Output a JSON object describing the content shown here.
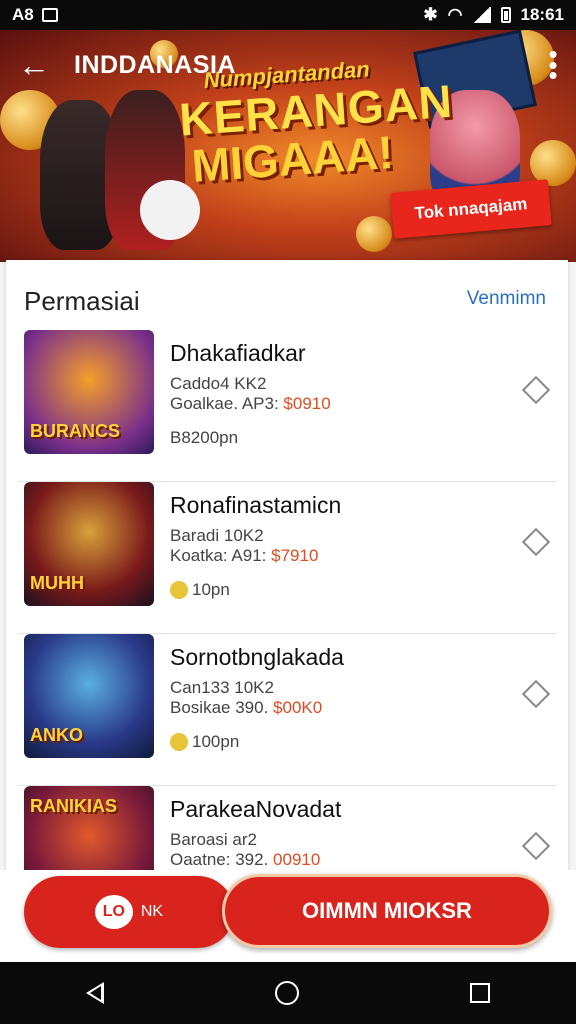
{
  "status_bar": {
    "left_text": "A8",
    "time": "18:61"
  },
  "header": {
    "title": "INDDANASIA"
  },
  "banner": {
    "line1": "Numpjantandan",
    "line2": "KERANGAN",
    "line3": "MIGAAA!",
    "cta": "Tok nnaqajam"
  },
  "section": {
    "title": "Permasiai",
    "view_all": "Venmimn"
  },
  "items": [
    {
      "name": "Dhakafiadkar",
      "meta1": "Caddo4 KK2",
      "meta2_prefix": "Goalkae. AP3:",
      "price": "$0910",
      "duration": "B8200pn",
      "thumb_text": "BURANCS",
      "has_dot": false
    },
    {
      "name": "Ronafinastamicn",
      "meta1": "Baradi 10K2",
      "meta2_prefix": "Koatka: A91:",
      "price": "$7910",
      "duration": "10pn",
      "thumb_text": "MUHH",
      "has_dot": true
    },
    {
      "name": "Sornotbnglakada",
      "meta1": "Can133 10K2",
      "meta2_prefix": "Bosikae 390.",
      "price": "$00K0",
      "duration": "100pn",
      "thumb_text": "ANKO",
      "has_dot": true
    },
    {
      "name": "ParakeaNovadat",
      "meta1": "Baroasi ar2",
      "meta2_prefix": "Oaatne: 392.",
      "price": "00910",
      "duration": "",
      "thumb_text": "RANIKIAS",
      "has_dot": false
    }
  ],
  "actions": {
    "chat_icon_text": "LO",
    "chat_label": "NK",
    "main_label": "OIMMN MIOKSR"
  },
  "colors": {
    "accent": "#d9231d",
    "link": "#2a6fc6",
    "price": "#e24a1f"
  }
}
